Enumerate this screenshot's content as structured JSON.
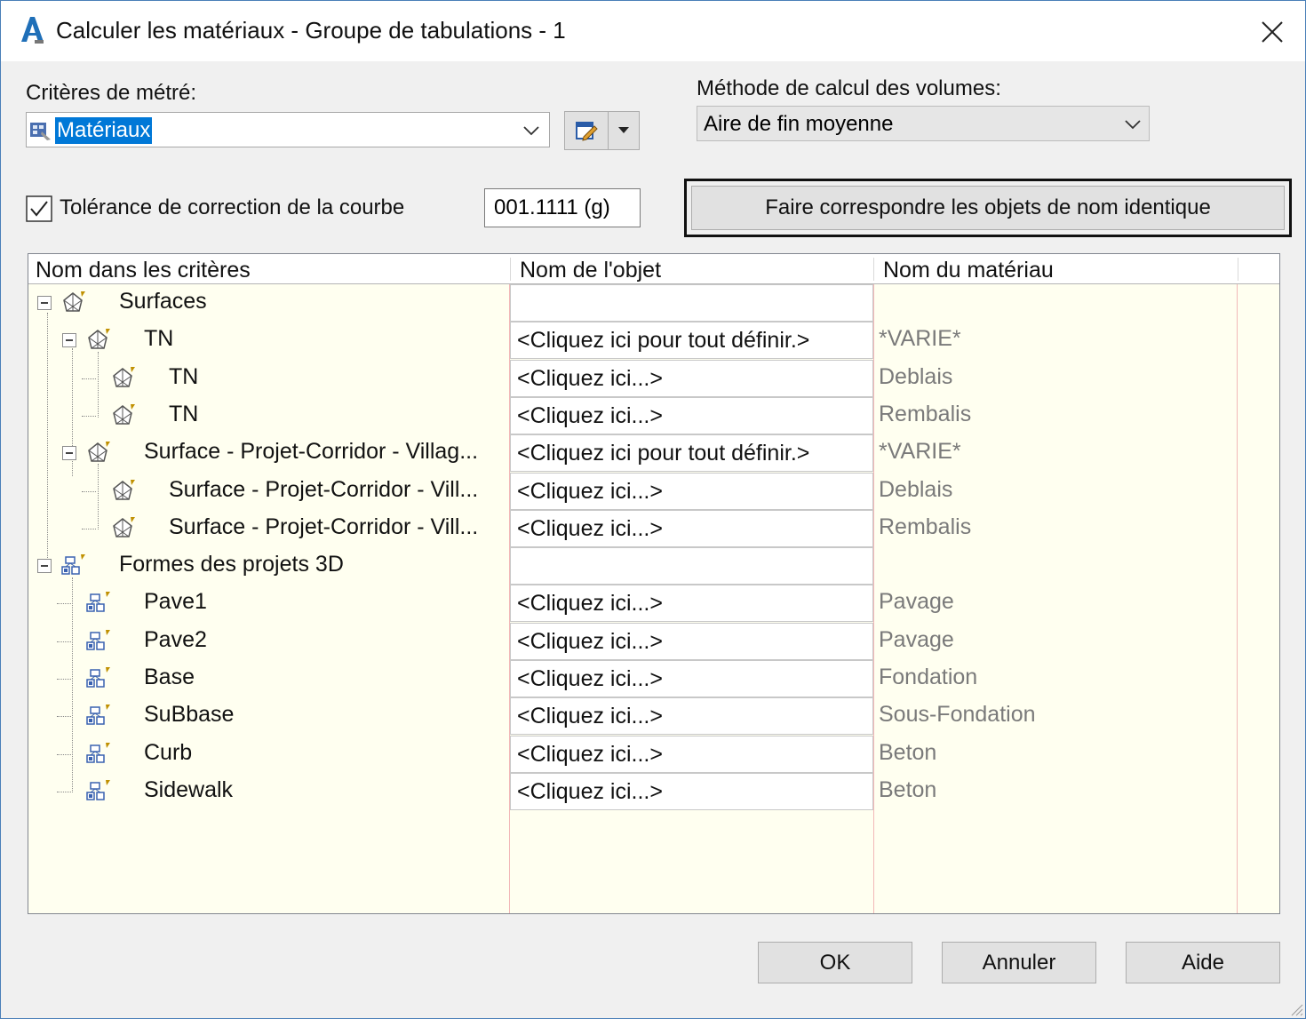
{
  "window": {
    "title": "Calculer les matériaux - Groupe de tabulations - 1"
  },
  "criteria": {
    "label": "Critères de métré:",
    "value": "Matériaux"
  },
  "volume_method": {
    "label": "Méthode de calcul des volumes:",
    "value": "Aire de fin moyenne"
  },
  "tolerance": {
    "label": "Tolérance de correction de la courbe",
    "checked": true,
    "value": "001.1111 (g)"
  },
  "match_button": {
    "label": "Faire correspondre les objets de nom identique"
  },
  "grid": {
    "columns": [
      "Nom dans les critères",
      "Nom de l'objet",
      "Nom du matériau"
    ],
    "rows": [
      {
        "name": "Surfaces",
        "object": "",
        "material": ""
      },
      {
        "name": "TN",
        "object": "<Cliquez ici pour tout définir.>",
        "material": "*VARIE*"
      },
      {
        "name": "TN",
        "object": "<Cliquez ici...>",
        "material": "Deblais"
      },
      {
        "name": "TN",
        "object": "<Cliquez ici...>",
        "material": "Rembalis"
      },
      {
        "name": "Surface - Projet-Corridor - Villag...",
        "object": "<Cliquez ici pour tout définir.>",
        "material": "*VARIE*"
      },
      {
        "name": "Surface - Projet-Corridor - Vill...",
        "object": "<Cliquez ici...>",
        "material": "Deblais"
      },
      {
        "name": "Surface - Projet-Corridor - Vill...",
        "object": "<Cliquez ici...>",
        "material": "Rembalis"
      },
      {
        "name": "Formes des projets 3D",
        "object": "",
        "material": ""
      },
      {
        "name": "Pave1",
        "object": "<Cliquez ici...>",
        "material": "Pavage"
      },
      {
        "name": "Pave2",
        "object": "<Cliquez ici...>",
        "material": "Pavage"
      },
      {
        "name": "Base",
        "object": "<Cliquez ici...>",
        "material": "Fondation"
      },
      {
        "name": "SuBbase",
        "object": "<Cliquez ici...>",
        "material": "Sous-Fondation"
      },
      {
        "name": "Curb",
        "object": "<Cliquez ici...>",
        "material": "Beton"
      },
      {
        "name": "Sidewalk",
        "object": "<Cliquez ici...>",
        "material": "Beton"
      }
    ]
  },
  "buttons": {
    "ok": "OK",
    "cancel": "Annuler",
    "help": "Aide"
  },
  "colors": {
    "grid_bg": "#fffff0",
    "selection": "#0078d7",
    "column_line": "#f2b8b8"
  },
  "icons": [
    "autocad-app-icon",
    "close-icon",
    "chevron-down-icon",
    "edit-style-icon",
    "dropdown-arrow-icon",
    "checkbox-checked-icon",
    "collapse-icon",
    "surface-icon",
    "corridor-shape-icon"
  ]
}
